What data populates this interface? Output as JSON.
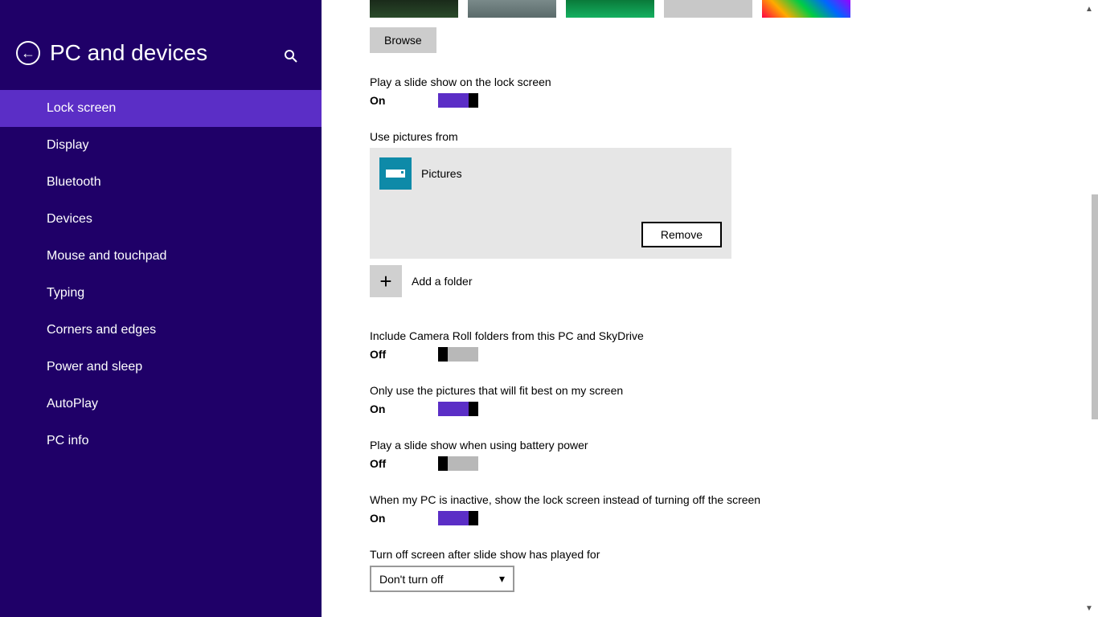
{
  "sidebar": {
    "title": "PC and devices",
    "items": [
      {
        "label": "Lock screen",
        "active": true
      },
      {
        "label": "Display"
      },
      {
        "label": "Bluetooth"
      },
      {
        "label": "Devices"
      },
      {
        "label": "Mouse and touchpad"
      },
      {
        "label": "Typing"
      },
      {
        "label": "Corners and edges"
      },
      {
        "label": "Power and sleep"
      },
      {
        "label": "AutoPlay"
      },
      {
        "label": "PC info"
      }
    ]
  },
  "settings": {
    "browse_label": "Browse",
    "slideshow": {
      "label": "Play a slide show on the lock screen",
      "state": "On"
    },
    "use_pictures_label": "Use pictures from",
    "folder_name": "Pictures",
    "remove_label": "Remove",
    "add_folder_label": "Add a folder",
    "camera_roll": {
      "label": "Include Camera Roll folders from this PC and SkyDrive",
      "state": "Off"
    },
    "fit_best": {
      "label": "Only use the pictures that will fit best on my screen",
      "state": "On"
    },
    "battery": {
      "label": "Play a slide show when using battery power",
      "state": "Off"
    },
    "inactive": {
      "label": "When my PC is inactive, show the lock screen instead of turning off the screen",
      "state": "On"
    },
    "turn_off": {
      "label": "Turn off screen after slide show has played for",
      "value": "Don't turn off"
    }
  }
}
